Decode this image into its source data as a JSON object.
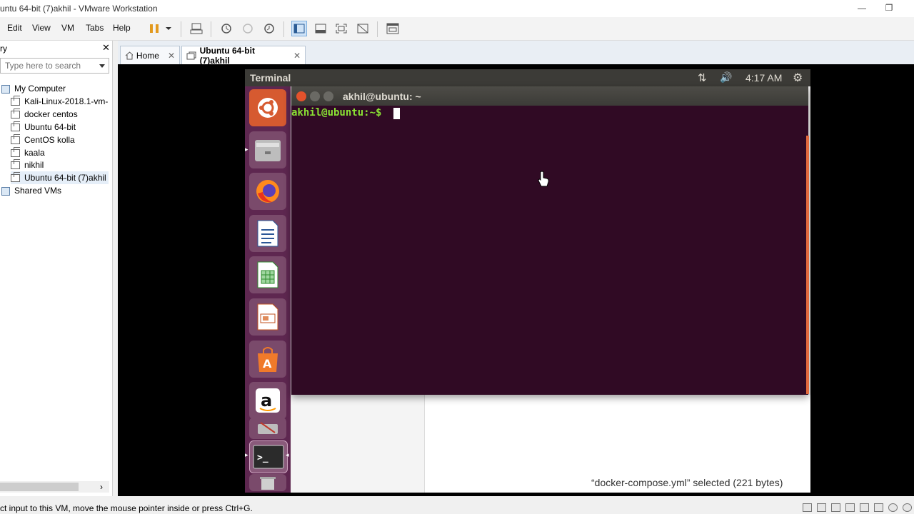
{
  "window": {
    "title": "untu 64-bit (7)akhil - VMware Workstation"
  },
  "menu": {
    "edit": "Edit",
    "view": "View",
    "vm": "VM",
    "tabs": "Tabs",
    "help": "Help"
  },
  "library": {
    "title": "ry",
    "search_placeholder": "Type here to search",
    "items": [
      {
        "label": "My Computer"
      },
      {
        "label": "Kali-Linux-2018.1-vm-"
      },
      {
        "label": "docker centos"
      },
      {
        "label": "Ubuntu 64-bit"
      },
      {
        "label": "CentOS kolla"
      },
      {
        "label": "kaala"
      },
      {
        "label": "nikhil"
      },
      {
        "label": "Ubuntu 64-bit (7)akhil"
      },
      {
        "label": "Shared VMs"
      }
    ]
  },
  "tabs": [
    {
      "label": "Home"
    },
    {
      "label": "Ubuntu 64-bit (7)akhil"
    }
  ],
  "guest": {
    "topbar_title": "Terminal",
    "clock": "4:17 AM",
    "terminal_title": "akhil@ubuntu: ~",
    "prompt": "akhil@ubuntu:~$ ",
    "fm_status": "“docker-compose.yml” selected  (221 bytes)"
  },
  "status": {
    "text": "ct input to this VM, move the mouse pointer inside or press Ctrl+G."
  },
  "colors": {
    "terminal_bg": "#300a24",
    "launcher_bg": "#5e2750",
    "prompt_green": "#8ae234",
    "topbar": "#3c3b37"
  }
}
